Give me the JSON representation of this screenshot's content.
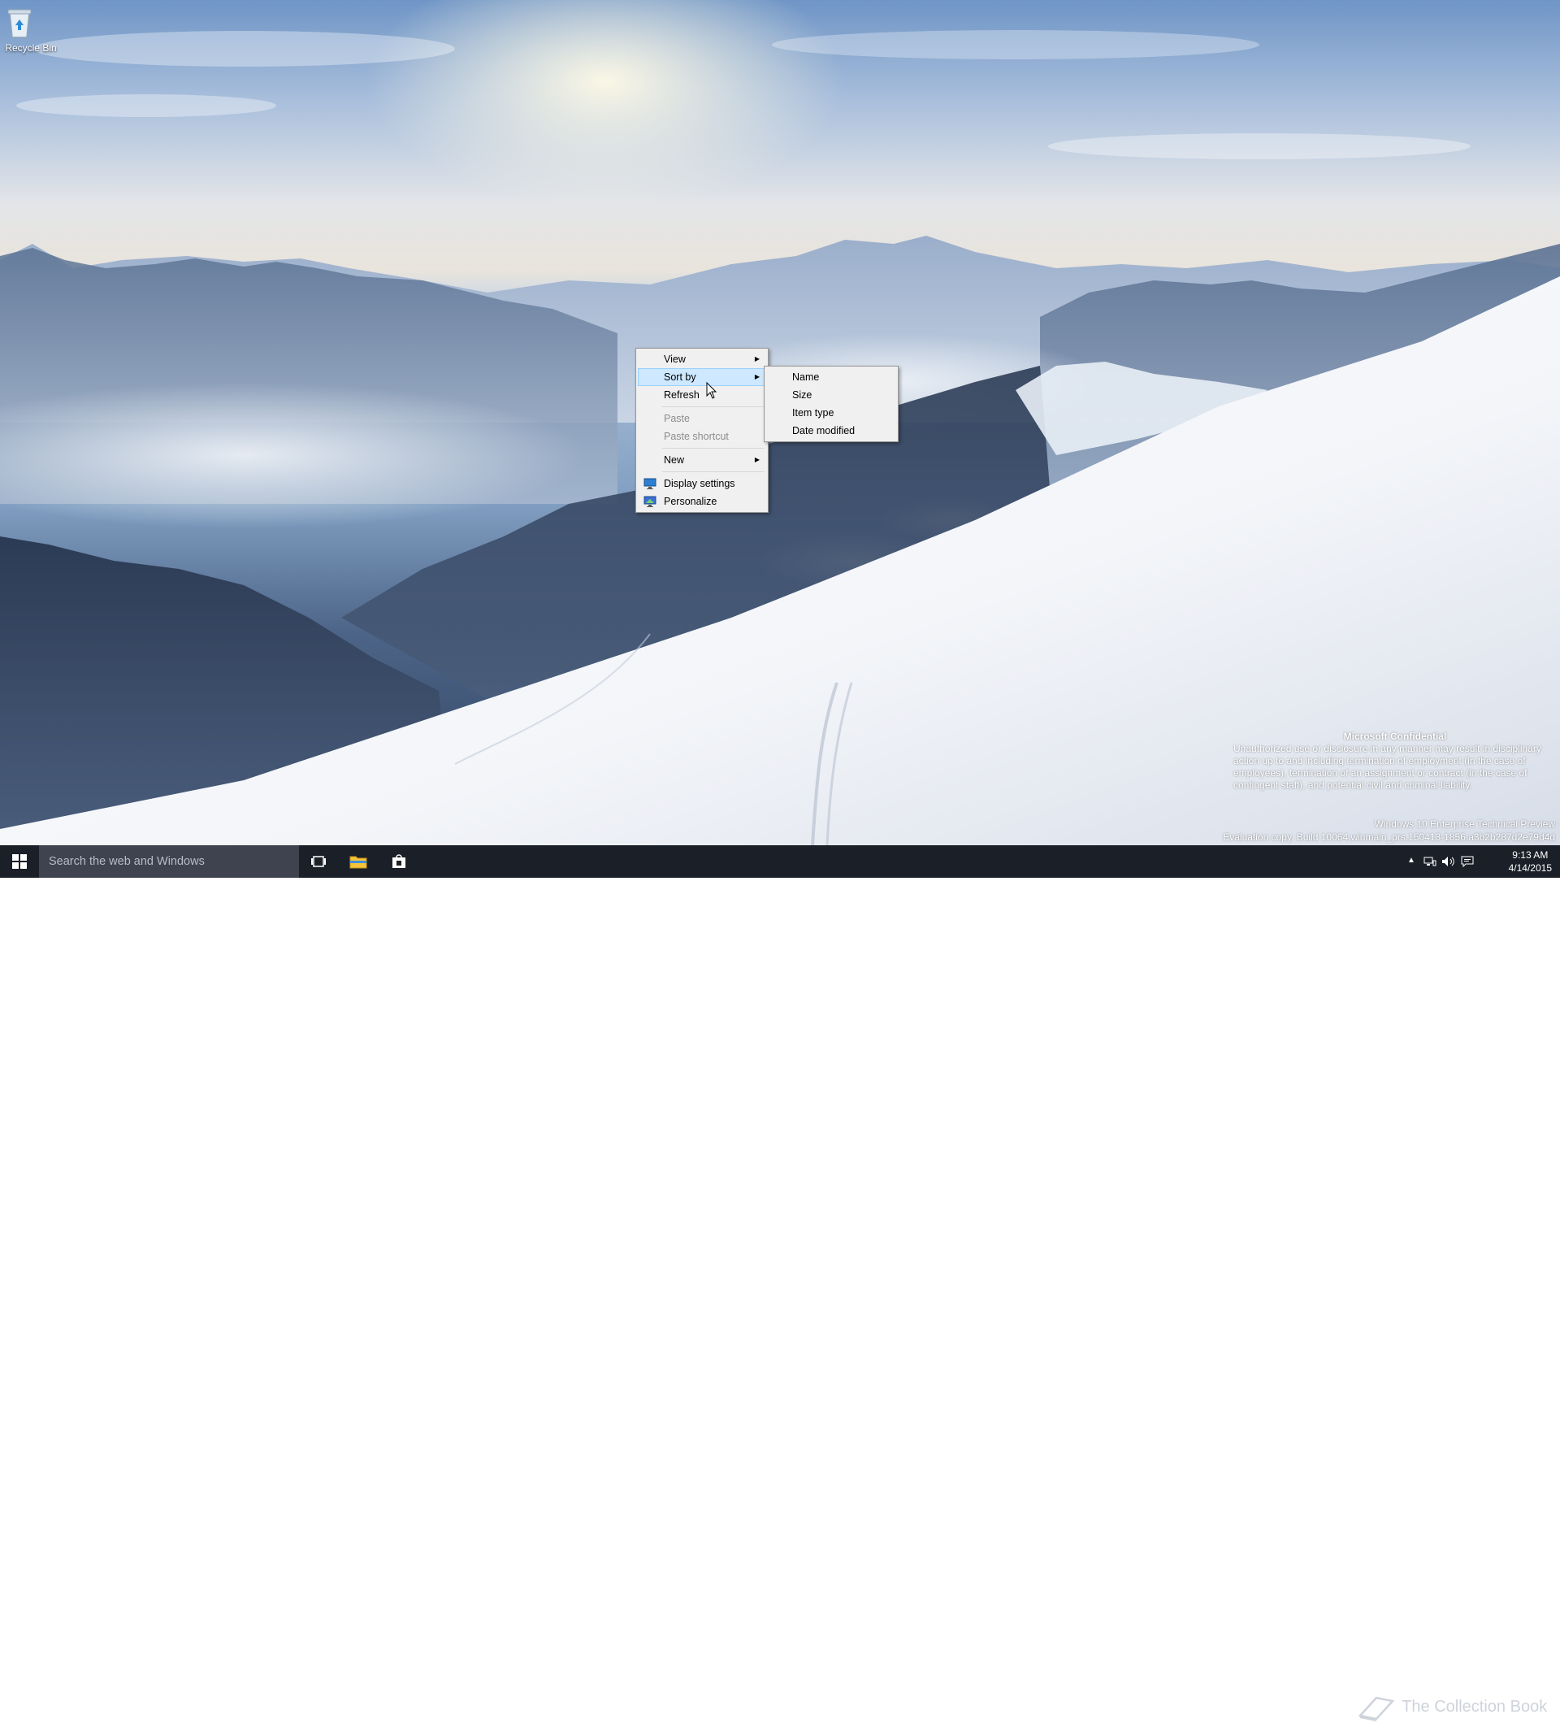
{
  "desktop": {
    "icons": [
      {
        "label": "Recycle Bin",
        "icon": "recycle-bin-icon"
      }
    ]
  },
  "context_menu": {
    "items": [
      {
        "label": "View",
        "submenu": true
      },
      {
        "label": "Sort by",
        "submenu": true,
        "highlighted": true
      },
      {
        "label": "Refresh"
      },
      {
        "label": "Paste",
        "disabled": true
      },
      {
        "label": "Paste shortcut",
        "disabled": true
      },
      {
        "label": "New",
        "submenu": true
      },
      {
        "label": "Display settings",
        "icon": "display-settings-icon"
      },
      {
        "label": "Personalize",
        "icon": "personalize-icon"
      }
    ],
    "submenu_arrow": "▶"
  },
  "sort_submenu": {
    "items": [
      {
        "label": "Name"
      },
      {
        "label": "Size"
      },
      {
        "label": "Item type"
      },
      {
        "label": "Date modified"
      }
    ]
  },
  "watermark": {
    "confidential_title": "Microsoft Confidential",
    "confidential_body": "Unauthorized use or disclosure in any manner may result in disciplinary action up to and including termination of employment (in the case of employees), termination of an assignment or contract (in the case of contingent staff), and potential civil and criminal liability.",
    "edition": "Windows 10 Enterprise Technical Preview",
    "build": "Evaluation copy. Build 10064.winmain_prs.150413-1856.a3b2b287d2e79d4d"
  },
  "taskbar": {
    "search_placeholder": "Search the web and Windows",
    "clock_time": "9:13 AM",
    "clock_date": "4/14/2015",
    "overlay_text": "The Collection Book"
  },
  "colors": {
    "taskbar": "#1b1f28",
    "search_box": "#3f4350",
    "menu_bg": "#f0f0f0",
    "menu_highlight": "#cde8ff"
  }
}
